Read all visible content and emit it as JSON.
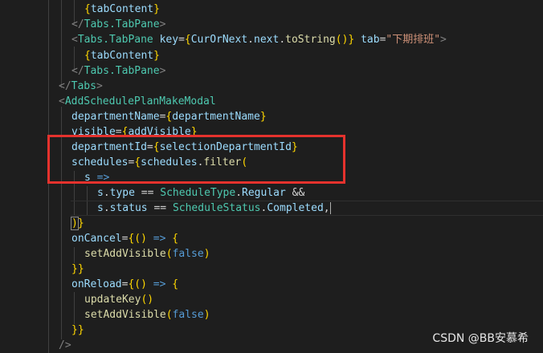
{
  "colors": {
    "background": "#1e1e1e",
    "tag": "#569cd6",
    "bracket": "#808080",
    "attribute": "#9cdcfe",
    "string": "#ce9178",
    "operator": "#d4d4d4",
    "variable": "#9cdcfe",
    "function": "#dcdcaa",
    "type": "#4ec9b0",
    "keyword": "#569cd6",
    "brace": "#ffd700",
    "highlight_box": "#e5322d"
  },
  "code_lines": [
    {
      "tokens": [
        {
          "t": "{",
          "c": "brace"
        },
        {
          "t": "tabContent",
          "c": "variable"
        },
        {
          "t": "}",
          "c": "brace"
        }
      ]
    },
    {
      "tokens": [
        {
          "t": "</",
          "c": "bracket"
        },
        {
          "t": "Tabs.TabPane",
          "c": "type"
        },
        {
          "t": ">",
          "c": "bracket"
        }
      ]
    },
    {
      "tokens": [
        {
          "t": "<",
          "c": "bracket"
        },
        {
          "t": "Tabs.TabPane",
          "c": "type"
        },
        {
          "t": " ",
          "c": "operator"
        },
        {
          "t": "key",
          "c": "attribute"
        },
        {
          "t": "=",
          "c": "operator"
        },
        {
          "t": "{",
          "c": "brace"
        },
        {
          "t": "CurOrNext",
          "c": "variable"
        },
        {
          "t": ".",
          "c": "operator"
        },
        {
          "t": "next",
          "c": "variable"
        },
        {
          "t": ".",
          "c": "operator"
        },
        {
          "t": "toString",
          "c": "function"
        },
        {
          "t": "()",
          "c": "brace"
        },
        {
          "t": "}",
          "c": "brace"
        },
        {
          "t": " ",
          "c": "operator"
        },
        {
          "t": "tab",
          "c": "attribute"
        },
        {
          "t": "=",
          "c": "operator"
        },
        {
          "t": "\"下期排班\"",
          "c": "string"
        },
        {
          "t": ">",
          "c": "bracket"
        }
      ]
    },
    {
      "tokens": [
        {
          "t": "{",
          "c": "brace"
        },
        {
          "t": "tabContent",
          "c": "variable"
        },
        {
          "t": "}",
          "c": "brace"
        }
      ]
    },
    {
      "tokens": [
        {
          "t": "</",
          "c": "bracket"
        },
        {
          "t": "Tabs.TabPane",
          "c": "type"
        },
        {
          "t": ">",
          "c": "bracket"
        }
      ]
    },
    {
      "tokens": [
        {
          "t": "</",
          "c": "bracket"
        },
        {
          "t": "Tabs",
          "c": "type"
        },
        {
          "t": ">",
          "c": "bracket"
        }
      ]
    },
    {
      "tokens": [
        {
          "t": "<",
          "c": "bracket"
        },
        {
          "t": "AddSchedulePlanMakeModal",
          "c": "type"
        }
      ]
    },
    {
      "tokens": [
        {
          "t": "departmentName",
          "c": "attribute"
        },
        {
          "t": "=",
          "c": "operator"
        },
        {
          "t": "{",
          "c": "brace"
        },
        {
          "t": "departmentName",
          "c": "variable"
        },
        {
          "t": "}",
          "c": "brace"
        }
      ]
    },
    {
      "tokens": [
        {
          "t": "visible",
          "c": "attribute"
        },
        {
          "t": "=",
          "c": "operator"
        },
        {
          "t": "{",
          "c": "brace"
        },
        {
          "t": "addVisible",
          "c": "variable"
        },
        {
          "t": "}",
          "c": "brace"
        }
      ]
    },
    {
      "tokens": [
        {
          "t": "departmentId",
          "c": "attribute"
        },
        {
          "t": "=",
          "c": "operator"
        },
        {
          "t": "{",
          "c": "brace"
        },
        {
          "t": "selectionDepartmentId",
          "c": "variable"
        },
        {
          "t": "}",
          "c": "brace"
        }
      ]
    },
    {
      "tokens": [
        {
          "t": "schedules",
          "c": "attribute"
        },
        {
          "t": "=",
          "c": "operator"
        },
        {
          "t": "{",
          "c": "brace"
        },
        {
          "t": "schedules",
          "c": "variable"
        },
        {
          "t": ".",
          "c": "operator"
        },
        {
          "t": "filter",
          "c": "function"
        },
        {
          "t": "(",
          "c": "brace"
        }
      ]
    },
    {
      "tokens": [
        {
          "t": "s",
          "c": "variable"
        },
        {
          "t": " ",
          "c": "operator"
        },
        {
          "t": "=>",
          "c": "keyword"
        }
      ]
    },
    {
      "tokens": [
        {
          "t": "s",
          "c": "variable"
        },
        {
          "t": ".",
          "c": "operator"
        },
        {
          "t": "type",
          "c": "variable"
        },
        {
          "t": " == ",
          "c": "operator"
        },
        {
          "t": "ScheduleType",
          "c": "type"
        },
        {
          "t": ".",
          "c": "operator"
        },
        {
          "t": "Regular",
          "c": "variable"
        },
        {
          "t": " &&",
          "c": "operator"
        }
      ]
    },
    {
      "tokens": [
        {
          "t": "s",
          "c": "variable"
        },
        {
          "t": ".",
          "c": "operator"
        },
        {
          "t": "status",
          "c": "variable"
        },
        {
          "t": " == ",
          "c": "operator"
        },
        {
          "t": "ScheduleStatus",
          "c": "type"
        },
        {
          "t": ".",
          "c": "operator"
        },
        {
          "t": "Completed",
          "c": "variable"
        },
        {
          "t": ",",
          "c": "operator"
        }
      ]
    },
    {
      "tokens": [
        {
          "t": ")",
          "c": "brace"
        },
        {
          "t": "}",
          "c": "brace"
        }
      ]
    },
    {
      "tokens": [
        {
          "t": "onCancel",
          "c": "attribute"
        },
        {
          "t": "=",
          "c": "operator"
        },
        {
          "t": "{",
          "c": "brace"
        },
        {
          "t": "()",
          "c": "brace"
        },
        {
          "t": " => ",
          "c": "keyword"
        },
        {
          "t": "{",
          "c": "brace"
        }
      ]
    },
    {
      "tokens": [
        {
          "t": "setAddVisible",
          "c": "function"
        },
        {
          "t": "(",
          "c": "brace"
        },
        {
          "t": "false",
          "c": "keyword"
        },
        {
          "t": ")",
          "c": "brace"
        }
      ]
    },
    {
      "tokens": [
        {
          "t": "}}",
          "c": "brace"
        }
      ]
    },
    {
      "tokens": [
        {
          "t": "onReload",
          "c": "attribute"
        },
        {
          "t": "=",
          "c": "operator"
        },
        {
          "t": "{",
          "c": "brace"
        },
        {
          "t": "()",
          "c": "brace"
        },
        {
          "t": " => ",
          "c": "keyword"
        },
        {
          "t": "{",
          "c": "brace"
        }
      ]
    },
    {
      "tokens": [
        {
          "t": "updateKey",
          "c": "function"
        },
        {
          "t": "()",
          "c": "brace"
        }
      ]
    },
    {
      "tokens": [
        {
          "t": "setAddVisible",
          "c": "function"
        },
        {
          "t": "(",
          "c": "brace"
        },
        {
          "t": "false",
          "c": "keyword"
        },
        {
          "t": ")",
          "c": "brace"
        }
      ]
    },
    {
      "tokens": [
        {
          "t": "}}",
          "c": "brace"
        }
      ]
    },
    {
      "tokens": [
        {
          "t": "/>",
          "c": "bracket"
        }
      ]
    }
  ],
  "watermark": "CSDN @BB安慕希"
}
